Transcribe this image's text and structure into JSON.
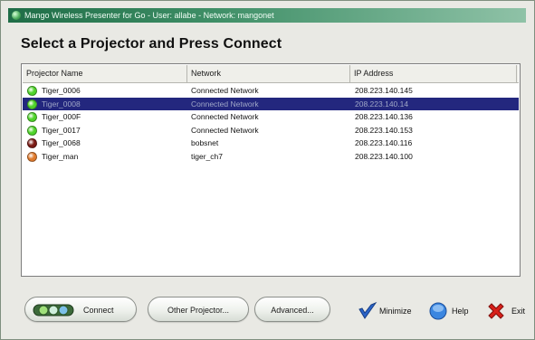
{
  "window": {
    "title": "Mango Wireless Presenter for Go - User: allabe - Network: mangonet"
  },
  "heading": "Select a Projector and Press Connect",
  "table": {
    "columns": [
      "Projector Name",
      "Network",
      "IP Address"
    ],
    "rows": [
      {
        "name": "Tiger_0006",
        "network": "Connected Network",
        "ip": "208.223.140.145",
        "status": "green",
        "selected": false
      },
      {
        "name": "Tiger_0008",
        "network": "Connected Network",
        "ip": "208.223.140.14",
        "status": "green",
        "selected": true
      },
      {
        "name": "Tiger_000F",
        "network": "Connected Network",
        "ip": "208.223.140.136",
        "status": "green",
        "selected": false
      },
      {
        "name": "Tiger_0017",
        "network": "Connected Network",
        "ip": "208.223.140.153",
        "status": "green",
        "selected": false
      },
      {
        "name": "Tiger_0068",
        "network": "bobsnet",
        "ip": "208.223.140.116",
        "status": "darkred",
        "selected": false
      },
      {
        "name": "Tiger_man",
        "network": "tiger_ch7",
        "ip": "208.223.140.100",
        "status": "orange",
        "selected": false
      }
    ]
  },
  "status_colors": {
    "green": "#4fd42a",
    "darkred": "#7a1a14",
    "orange": "#e07a2c"
  },
  "buttons": {
    "connect": "Connect",
    "other_projector": "Other Projector...",
    "advanced": "Advanced..."
  },
  "actions": {
    "minimize": "Minimize",
    "help": "Help",
    "exit": "Exit"
  },
  "icons": {
    "app": "app-logo-icon",
    "connect": "connect-plug-icon",
    "minimize": "checkmark-icon",
    "help": "help-icon",
    "exit": "close-x-icon"
  }
}
